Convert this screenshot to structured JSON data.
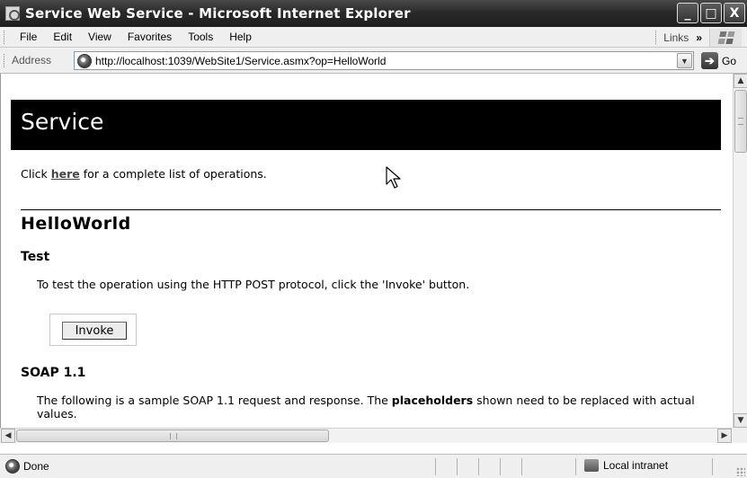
{
  "window": {
    "title": "Service Web Service - Microsoft Internet Explorer",
    "minimize_glyph": "_",
    "maximize_glyph": "□",
    "close_glyph": "X"
  },
  "menu": {
    "items": [
      "File",
      "Edit",
      "View",
      "Favorites",
      "Tools",
      "Help"
    ],
    "links_label": "Links",
    "links_chevron": "»"
  },
  "address": {
    "label": "Address",
    "url": "http://localhost:1039/WebSite1/Service.asmx?op=HelloWorld",
    "dropdown_glyph": "▼",
    "go_arrow": "➔",
    "go_label": "Go"
  },
  "page": {
    "heading": "Service",
    "intro_prefix": "Click ",
    "intro_link": "here",
    "intro_suffix": " for a complete list of operations.",
    "operation_title": "HelloWorld",
    "test_title": "Test",
    "test_text": "To test the operation using the HTTP POST protocol, click the 'Invoke' button.",
    "invoke_label": "Invoke",
    "soap_title": "SOAP 1.1",
    "soap_text_prefix": "The following is a sample SOAP 1.1 request and response. The ",
    "soap_text_bold": "placeholders",
    "soap_text_suffix": " shown need to be replaced with actual values."
  },
  "scrollbars": {
    "up_glyph": "▲",
    "down_glyph": "▼",
    "left_glyph": "◀",
    "right_glyph": "▶"
  },
  "status": {
    "text": "Done",
    "zone": "Local intranet"
  }
}
